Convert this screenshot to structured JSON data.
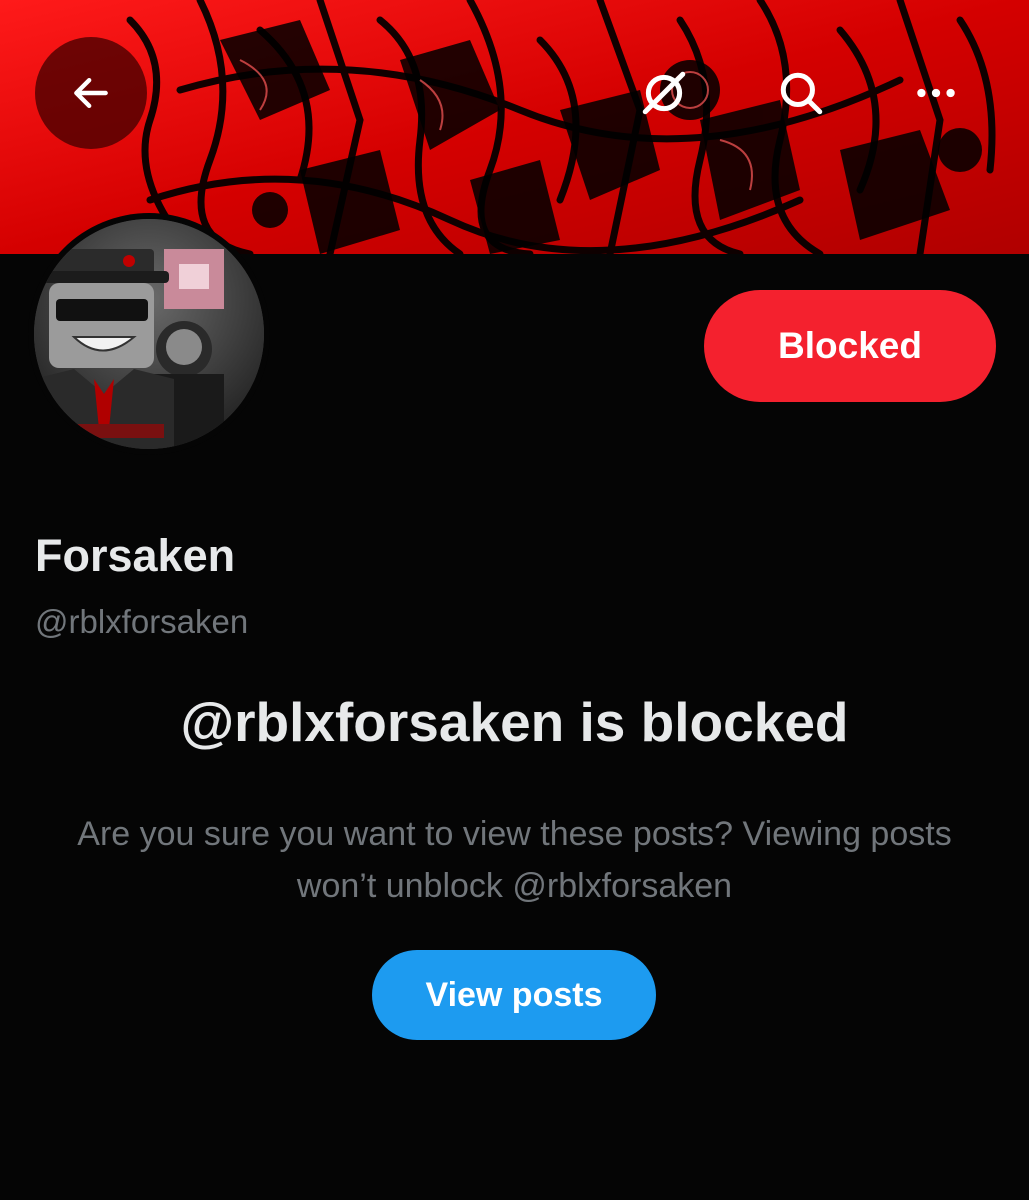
{
  "header": {
    "back_icon": "arrow-left-icon",
    "grok_icon": "grok-icon",
    "search_icon": "search-icon",
    "more_icon": "more-horizontal-icon"
  },
  "profile": {
    "blocked_button_label": "Blocked",
    "display_name": "Forsaken",
    "handle": "@rblxforsaken"
  },
  "blocked_notice": {
    "title": "@rblxforsaken is blocked",
    "description": "Are you sure you want to view these posts? Viewing posts won’t unblock @rblxforsaken",
    "view_posts_label": "View posts"
  },
  "colors": {
    "background": "#050505",
    "banner_red": "#d00000",
    "blocked_red": "#f4212e",
    "accent_blue": "#1d9bf0",
    "text_primary": "#e7e9ea",
    "text_secondary": "#71767b"
  }
}
